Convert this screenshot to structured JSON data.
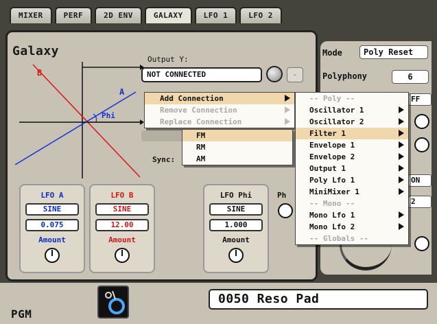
{
  "tabs": [
    "MIXER",
    "PERF",
    "2D ENV",
    "GALAXY",
    "LFO 1",
    "LFO 2"
  ],
  "active_tab": "GALAXY",
  "panel": {
    "title": "Galaxy",
    "diagram": {
      "axis_b": "B",
      "axis_a": "A",
      "angle": "Phi"
    },
    "output_label": "Output Y:",
    "output_value": "NOT CONNECTED",
    "output_dash": "-",
    "sync_label": "Sync:"
  },
  "lfos": [
    {
      "title": "LFO A",
      "wave": "SINE",
      "value": "0.075",
      "amount_label": "Amount",
      "color": "#0a2cc7"
    },
    {
      "title": "LFO B",
      "wave": "SINE",
      "value": "12.00",
      "amount_label": "Amount",
      "color": "#d01717"
    },
    {
      "title": "LFO Phi",
      "wave": "SINE",
      "value": "1.000",
      "amount_label": "Amount",
      "color": "#111111"
    }
  ],
  "phi_partial_label": "Ph",
  "right_panel": {
    "mode_label": "Mode",
    "mode_value": "Poly Reset",
    "polyphony_label": "Polyphony",
    "polyphony_value": "6",
    "ff_value": "FF",
    "on_value": "ON",
    "two_value": "2"
  },
  "menu_main": [
    {
      "label": "Add Connection",
      "state": "highlight",
      "submenu": true
    },
    {
      "label": "Remove Connection",
      "state": "disabled",
      "submenu": true
    },
    {
      "label": "Replace Connection",
      "state": "disabled",
      "submenu": true
    }
  ],
  "menu_type": [
    {
      "label": "FM",
      "state": "highlight"
    },
    {
      "label": "RM",
      "state": "normal"
    },
    {
      "label": "AM",
      "state": "normal"
    }
  ],
  "menu_targets": [
    {
      "label": "-- Poly --",
      "state": "separator",
      "submenu": false
    },
    {
      "label": "Oscillator 1",
      "state": "normal",
      "submenu": true
    },
    {
      "label": "Oscillator 2",
      "state": "normal",
      "submenu": true
    },
    {
      "label": "Filter 1",
      "state": "highlight",
      "submenu": true
    },
    {
      "label": "Envelope 1",
      "state": "normal",
      "submenu": true
    },
    {
      "label": "Envelope 2",
      "state": "normal",
      "submenu": true
    },
    {
      "label": "Output 1",
      "state": "normal",
      "submenu": true
    },
    {
      "label": "Poly Lfo 1",
      "state": "normal",
      "submenu": true
    },
    {
      "label": "MiniMixer 1",
      "state": "normal",
      "submenu": true
    },
    {
      "label": "-- Mono --",
      "state": "separator",
      "submenu": false
    },
    {
      "label": "Mono Lfo 1",
      "state": "normal",
      "submenu": true
    },
    {
      "label": "Mono Lfo 2",
      "state": "normal",
      "submenu": true
    },
    {
      "label": "-- Globals --",
      "state": "separator",
      "submenu": false
    }
  ],
  "footer": {
    "pgm_label": "PGM",
    "patch_name": "0050 Reso Pad"
  }
}
